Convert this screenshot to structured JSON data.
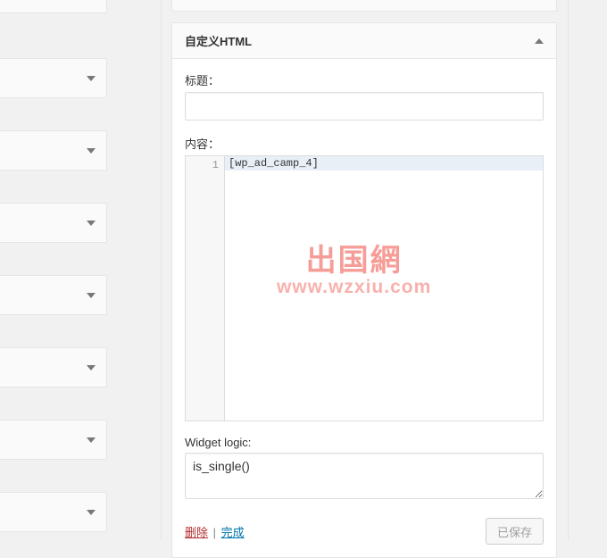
{
  "widget": {
    "header_title": "自定义HTML",
    "title_label": "标题：",
    "title_value": "",
    "content_label": "内容：",
    "code_line_number": "1",
    "code_content": "[wp_ad_camp_4]",
    "widget_logic_label": "Widget logic:",
    "widget_logic_value": "is_single()"
  },
  "actions": {
    "delete": "删除",
    "separator": "|",
    "done": "完成",
    "saved": "已保存"
  },
  "watermark": {
    "line1": "出国網",
    "line2": "www.wzxiu.com"
  }
}
